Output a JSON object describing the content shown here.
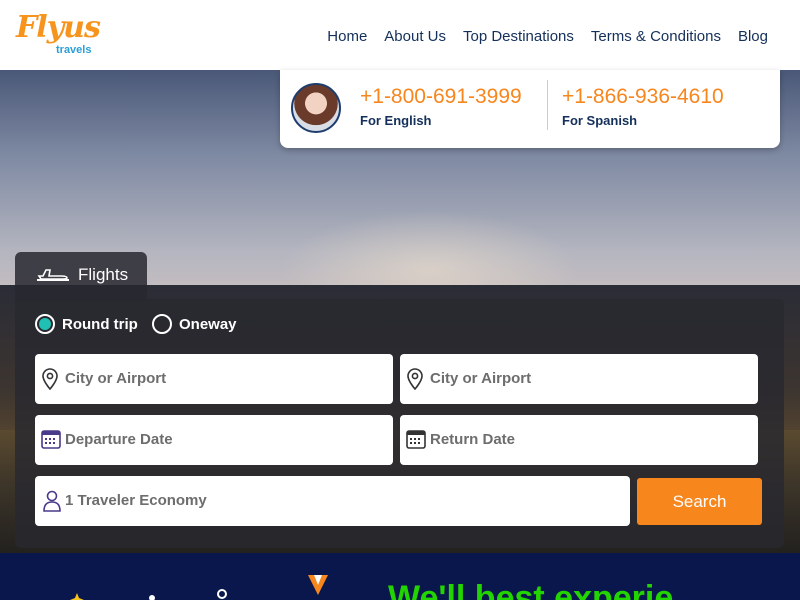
{
  "brand": {
    "name": "Flyus",
    "tagline": "travels"
  },
  "nav": [
    "Home",
    "About Us",
    "Top Destinations",
    "Terms & Conditions",
    "Blog"
  ],
  "contact": [
    {
      "phone": "+1-800-691-3999",
      "label": "For English"
    },
    {
      "phone": "+1-866-936-4610",
      "label": "For Spanish"
    }
  ],
  "tab": {
    "label": "Flights"
  },
  "trip_type": {
    "options": [
      "Round trip",
      "Oneway"
    ],
    "selected": "Round trip"
  },
  "fields": {
    "from_placeholder": "City or Airport",
    "to_placeholder": "City or Airport",
    "departure_placeholder": "Departure Date",
    "return_placeholder": "Return Date",
    "travelers": "1 Traveler Economy"
  },
  "search_label": "Search",
  "banner": {
    "text": "We'll best experie"
  },
  "colors": {
    "accent": "#f7861d",
    "navy": "#14305a",
    "radio": "#20c0b4",
    "banner_bg": "#0a174d",
    "banner_text": "#22d400"
  },
  "icons": [
    "plane-icon",
    "location-pin-icon",
    "calendar-icon",
    "person-icon"
  ]
}
